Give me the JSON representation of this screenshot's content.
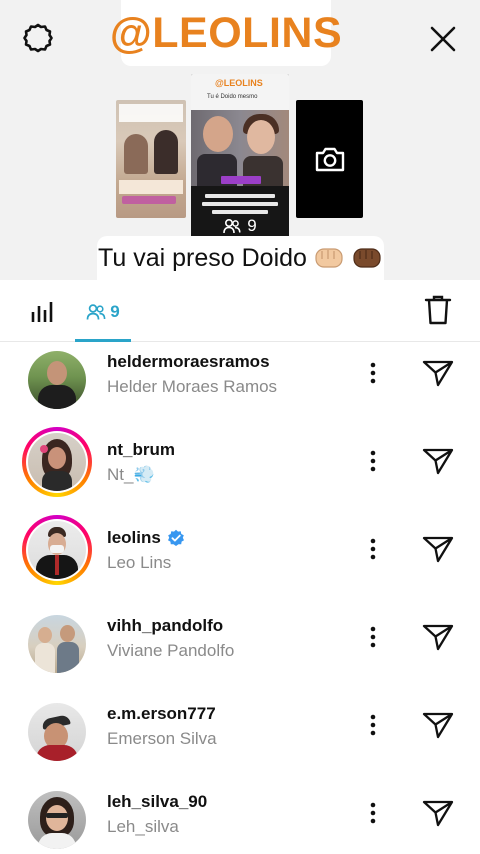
{
  "header": {
    "brand": "@LEOLINS",
    "settings_icon": "gear-icon",
    "close_icon": "close-icon"
  },
  "story_preview": {
    "center_brand": "@LEOLINS",
    "center_subtitle": "Tu é Doido mesmo",
    "center_badge": "FAMOSOS",
    "center_headline": "LEO LINS FAZ PIADA COM CÂNCER DE PRETA GIL APÓS CONDENAÇÃO",
    "viewer_count": "9",
    "camera_icon": "camera-icon"
  },
  "caption": {
    "text": "Tu vai preso Doido"
  },
  "tabs": {
    "insights_icon": "bar-chart-icon",
    "viewers_icon": "people-icon",
    "viewers_count": "9",
    "delete_icon": "trash-icon"
  },
  "colors": {
    "brand_orange": "#e8821f",
    "accent_blue": "#2aa4c9",
    "verified_blue": "#3897f0",
    "secondary_text": "#8a8a8a"
  },
  "viewers": [
    {
      "username": "heldermoraesramos",
      "full_name": "Helder Moraes Ramos",
      "story_ring": false,
      "verified": false
    },
    {
      "username": "nt_brum",
      "full_name": "Nt_💨",
      "story_ring": true,
      "verified": false
    },
    {
      "username": "leolins",
      "full_name": "Leo Lins",
      "story_ring": true,
      "verified": true
    },
    {
      "username": "vihh_pandolfo",
      "full_name": "Viviane Pandolfo",
      "story_ring": false,
      "verified": false
    },
    {
      "username": "e.m.erson777",
      "full_name": "Emerson Silva",
      "story_ring": false,
      "verified": false
    },
    {
      "username": "leh_silva_90",
      "full_name": "Leh_silva",
      "story_ring": false,
      "verified": false
    }
  ]
}
